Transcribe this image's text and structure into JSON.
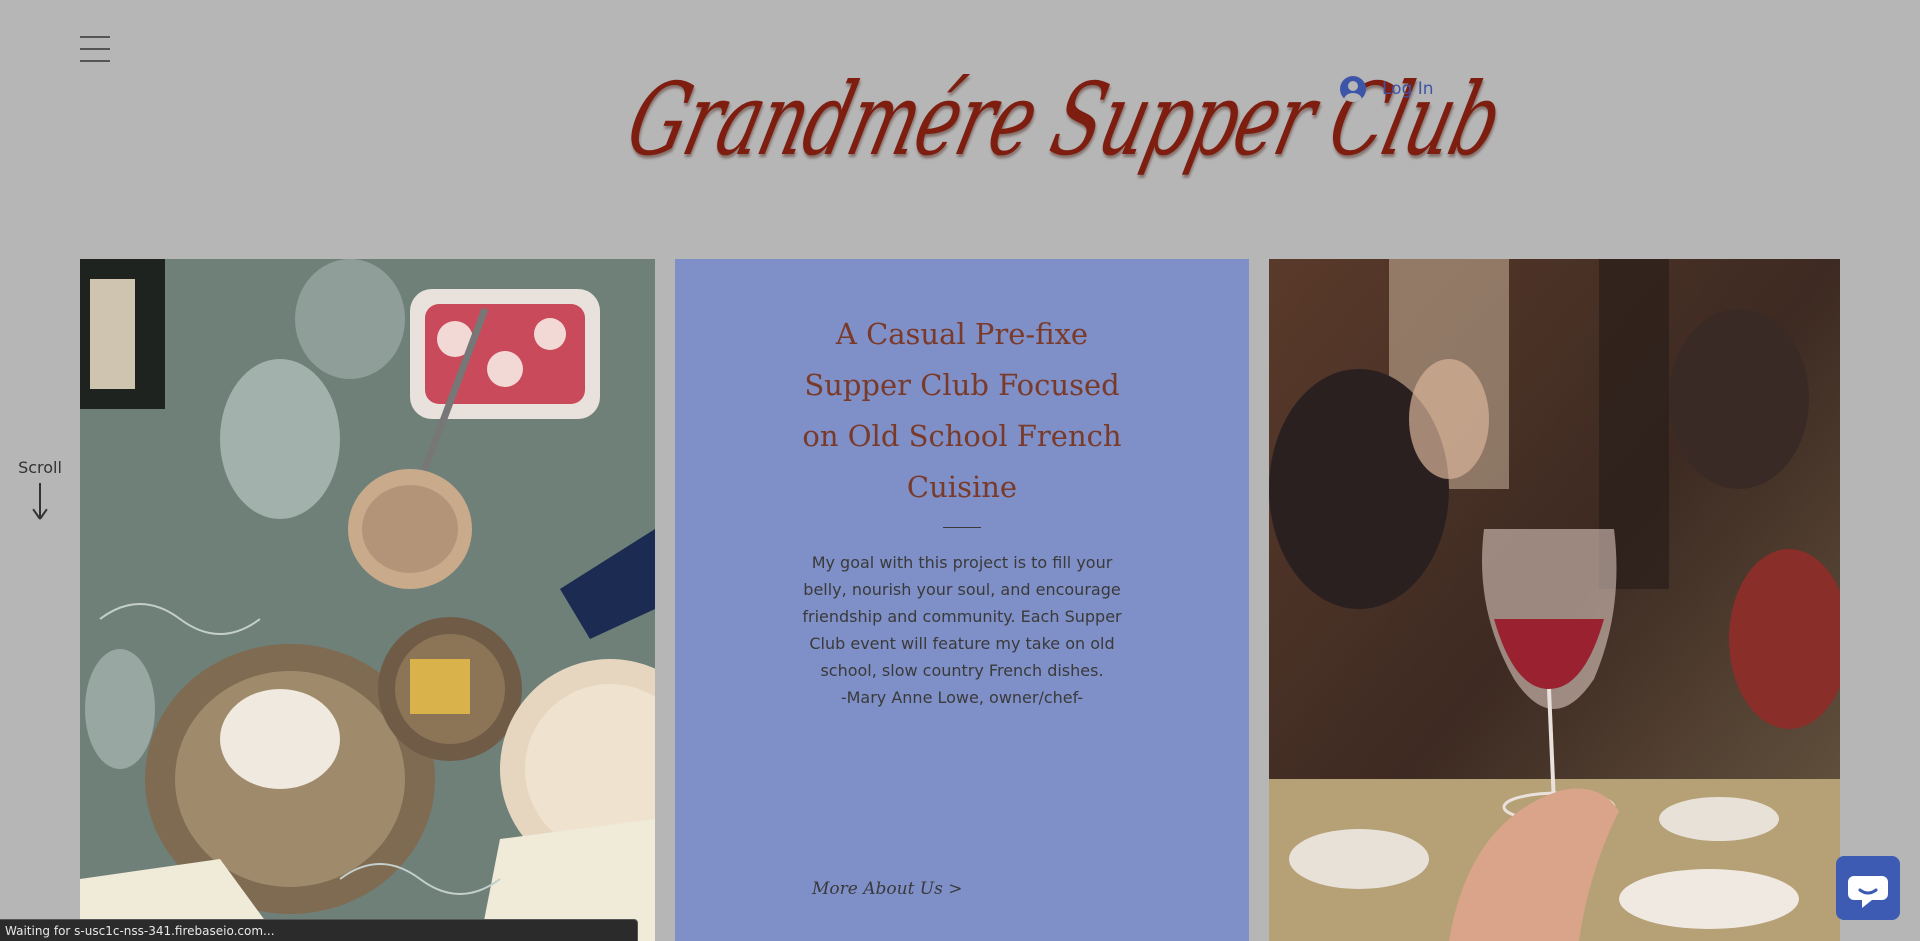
{
  "header": {
    "menu_icon": "hamburger-menu-icon",
    "logo_text": "Grandmére Supper Club",
    "login": {
      "icon": "user-avatar-icon",
      "label": "Log In"
    }
  },
  "scroll_indicator": {
    "label": "Scroll",
    "icon": "arrow-down-icon"
  },
  "images": {
    "left": "overhead-dinner-table-photo",
    "right": "raised-wine-glass-photo"
  },
  "intro_panel": {
    "heading": "A Casual Pre-fixe Supper Club Focused on Old School French Cuisine",
    "body": "My goal with this project is to fill your belly, nourish your soul, and encourage friendship and community.  Each Supper Club event will feature my take on old school, slow country French dishes.\n-Mary Anne Lowe, owner/chef-",
    "link": "More About Us >"
  },
  "chat_widget": {
    "icon": "chat-bubble-icon"
  },
  "status_bar": {
    "text": "Waiting for s-usc1c-nss-341.firebaseio.com..."
  },
  "colors": {
    "page_background": "#b6b6b6",
    "panel_background": "#7f8fc7",
    "logo_color": "#7e1e10",
    "heading_color": "#7a3a2a",
    "accent_blue": "#3d55a8"
  }
}
